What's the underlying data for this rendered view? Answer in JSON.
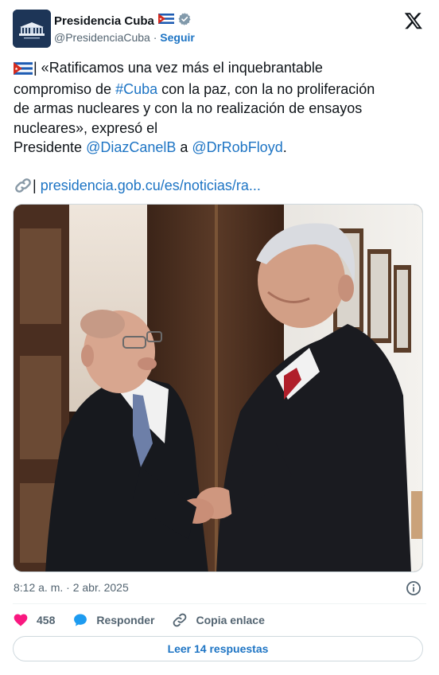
{
  "author": {
    "display_name": "Presidencia Cuba",
    "handle": "@PresidenciaCuba",
    "separator": " · ",
    "follow_label": "Seguir"
  },
  "tweet": {
    "line1": "| «Ratificamos una vez más el inquebrantable",
    "line2_a": "compromiso de ",
    "hashtag": "#Cuba",
    "line2_b": " con la paz, con la no proliferación",
    "line3": "de armas nucleares y con la no realización de ensayos",
    "line4": "nucleares», expresó el",
    "line5_a": "Presidente ",
    "mention1": "@DiazCanelB",
    "line5_b": " a ",
    "mention2": "@DrRobFloyd",
    "line5_c": ".",
    "link_prefix": "| ",
    "link_text": "presidencia.gob.cu/es/noticias/ra..."
  },
  "meta": {
    "timestamp": "8:12 a. m. · 2 abr. 2025"
  },
  "actions": {
    "like_count": "458",
    "reply_label": "Responder",
    "copy_label": "Copia enlace"
  },
  "replies_button": "Leer 14 respuestas",
  "colors": {
    "link": "#1d74c4",
    "like": "#f91880",
    "reply": "#1d9bf0",
    "text": "#0f1419",
    "muted": "#536471"
  },
  "icons": [
    "cuba-flag-icon",
    "verified-badge-icon",
    "x-logo-icon",
    "link-icon",
    "info-icon",
    "heart-icon",
    "reply-bubble-icon",
    "copy-link-icon"
  ]
}
